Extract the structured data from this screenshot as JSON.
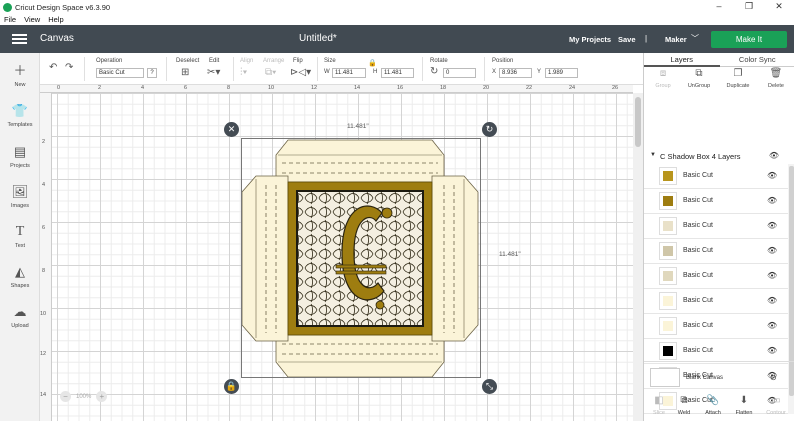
{
  "app": {
    "title": "Cricut Design Space  v6.3.90",
    "menu": [
      "File",
      "View",
      "Help"
    ]
  },
  "header": {
    "section": "Canvas",
    "project_title": "Untitled*",
    "my_projects": "My Projects",
    "save": "Save",
    "separator": "|",
    "machine": "Maker",
    "make_it": "Make It"
  },
  "toolbar": {
    "operation_label": "Operation",
    "operation_value": "Basic Cut",
    "deselect_label": "Deselect",
    "edit_label": "Edit",
    "align_label": "Align",
    "arrange_label": "Arrange",
    "flip_label": "Flip",
    "size_label": "Size",
    "w_label": "W",
    "w_value": "11.481",
    "h_label": "H",
    "h_value": "11.481",
    "rotate_label": "Rotate",
    "rotate_value": "0",
    "position_label": "Position",
    "x_label": "X",
    "x_value": "8.936",
    "y_label": "Y",
    "y_value": "1.989"
  },
  "sidebar": [
    {
      "label": "New",
      "icon": "plus-icon"
    },
    {
      "label": "Templates",
      "icon": "shirt-icon"
    },
    {
      "label": "Projects",
      "icon": "projects-icon"
    },
    {
      "label": "Images",
      "icon": "image-icon"
    },
    {
      "label": "Text",
      "icon": "text-icon"
    },
    {
      "label": "Shapes",
      "icon": "shapes-icon"
    },
    {
      "label": "Upload",
      "icon": "upload-icon"
    }
  ],
  "rulers": {
    "h": [
      "0",
      "2",
      "4",
      "6",
      "8",
      "10",
      "12",
      "14",
      "16",
      "18",
      "20",
      "22",
      "24",
      "26"
    ],
    "v": [
      "2",
      "4",
      "6",
      "8",
      "10",
      "12",
      "14"
    ]
  },
  "canvas": {
    "width_label": "11.481\"",
    "height_label": "11.481\"",
    "zoom": "100%"
  },
  "panel": {
    "tabs": [
      "Layers",
      "Color Sync"
    ],
    "actions": [
      "Group",
      "UnGroup",
      "Duplicate",
      "Delete"
    ],
    "group_name": "C Shadow Box 4 Layers",
    "layers": [
      {
        "name": "Basic Cut",
        "color": "#b8951c"
      },
      {
        "name": "Basic Cut",
        "color": "#9e7d10"
      },
      {
        "name": "Basic Cut",
        "color": "#e9e1c9"
      },
      {
        "name": "Basic Cut",
        "color": "#cfc6a8"
      },
      {
        "name": "Basic Cut",
        "color": "#e0d8bd"
      },
      {
        "name": "Basic Cut",
        "color": "#fbf4d8"
      },
      {
        "name": "Basic Cut",
        "color": "#fbf4d8"
      },
      {
        "name": "Basic Cut",
        "color": "#000000"
      },
      {
        "name": "Basic Cut",
        "color": "#fbf4d8"
      },
      {
        "name": "Basic Cut",
        "color": "#fbf4d8"
      }
    ],
    "blank_canvas": "Blank Canvas",
    "bottom_actions": [
      "Slice",
      "Weld",
      "Attach",
      "Flatten",
      "Contour"
    ]
  },
  "colors": {
    "header": "#414a52",
    "accent": "#1aa157",
    "gold": "#9e7d10",
    "cream": "#fbf4d8"
  }
}
